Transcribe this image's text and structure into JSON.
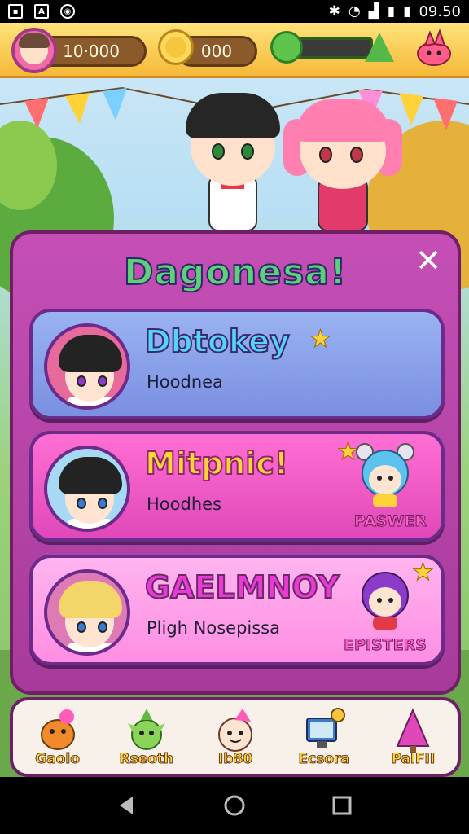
{
  "status_bar": {
    "time": "09.50",
    "left_icons": [
      "notification-icon",
      "app-icon",
      "sync-icon"
    ],
    "right_icons": [
      "bluetooth-icon",
      "wifi-icon",
      "signal-icon",
      "battery-icon"
    ]
  },
  "resources": {
    "coins_value": "10·000",
    "gold_value": "000",
    "energy_level": 0.0
  },
  "modal": {
    "title": "Dagonesa!",
    "close_label": "✕",
    "cards": [
      {
        "title": "Dbtokey",
        "subtitle": "Hoodnea",
        "badge": ""
      },
      {
        "title": "Mitpnic!",
        "subtitle": "Hoodhes",
        "badge": "PASWER"
      },
      {
        "title": "GAELMNOY",
        "subtitle": "Pligh Nosepissa",
        "badge": "EPISTERS"
      }
    ]
  },
  "bottom_nav": {
    "items": [
      {
        "label": "Gaolo",
        "icon": "creature-icon"
      },
      {
        "label": "Rseoth",
        "icon": "sprout-icon"
      },
      {
        "label": "Ib80",
        "icon": "party-face-icon"
      },
      {
        "label": "Ecsora",
        "icon": "computer-icon"
      },
      {
        "label": "PalFII",
        "icon": "tree-icon"
      }
    ]
  },
  "colors": {
    "modal": "#b846a9",
    "card_blue": "#8aa2ea",
    "card_magenta": "#ec55c6",
    "card_pink": "#ffa3ea",
    "accent_yellow": "#ffd23a"
  }
}
